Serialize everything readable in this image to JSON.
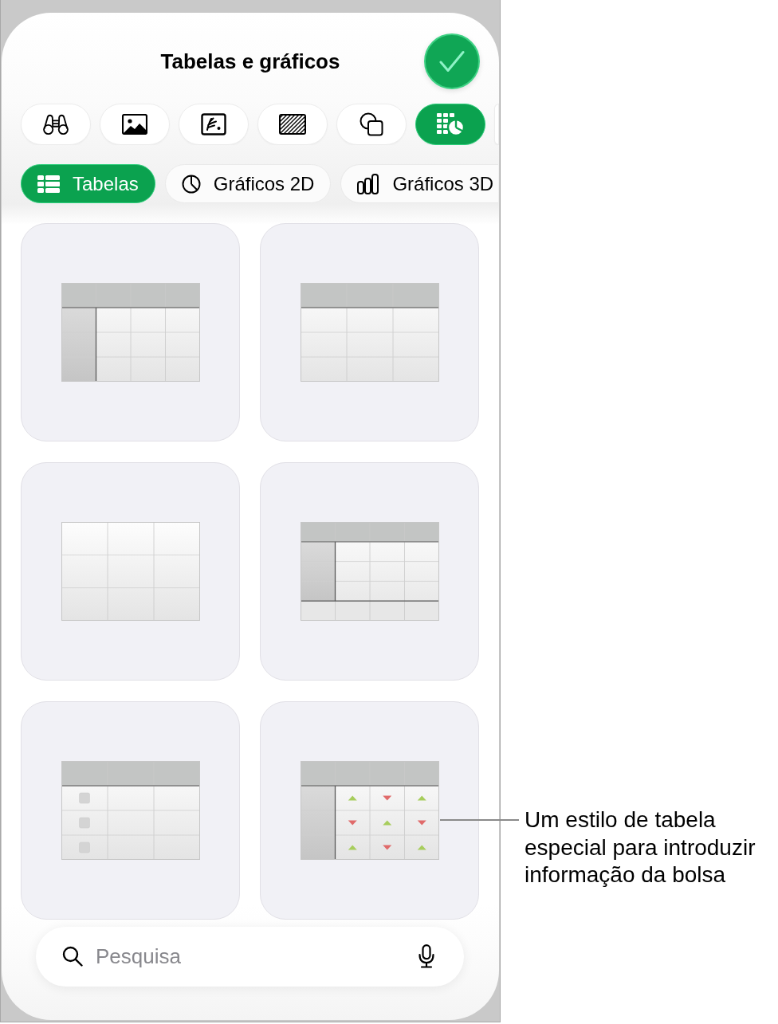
{
  "header": {
    "title": "Tabelas e gráficos"
  },
  "categories": [
    {
      "selected": false
    },
    {
      "selected": false
    },
    {
      "selected": false
    },
    {
      "selected": false
    },
    {
      "selected": false
    },
    {
      "selected": true
    },
    {
      "selected": false
    }
  ],
  "tabs": [
    {
      "label": "Tabelas",
      "selected": true
    },
    {
      "label": "Gráficos 2D",
      "selected": false
    },
    {
      "label": "Gráficos 3D",
      "selected": false
    }
  ],
  "table_styles": [
    {
      "kind": "header-row-column"
    },
    {
      "kind": "header-row"
    },
    {
      "kind": "plain"
    },
    {
      "kind": "header-row-column-footer"
    },
    {
      "kind": "checkbox-column"
    },
    {
      "kind": "stock-arrows",
      "callout": "Um estilo de tabela especial para introduzir informação da bolsa"
    }
  ],
  "search": {
    "placeholder": "Pesquisa"
  }
}
